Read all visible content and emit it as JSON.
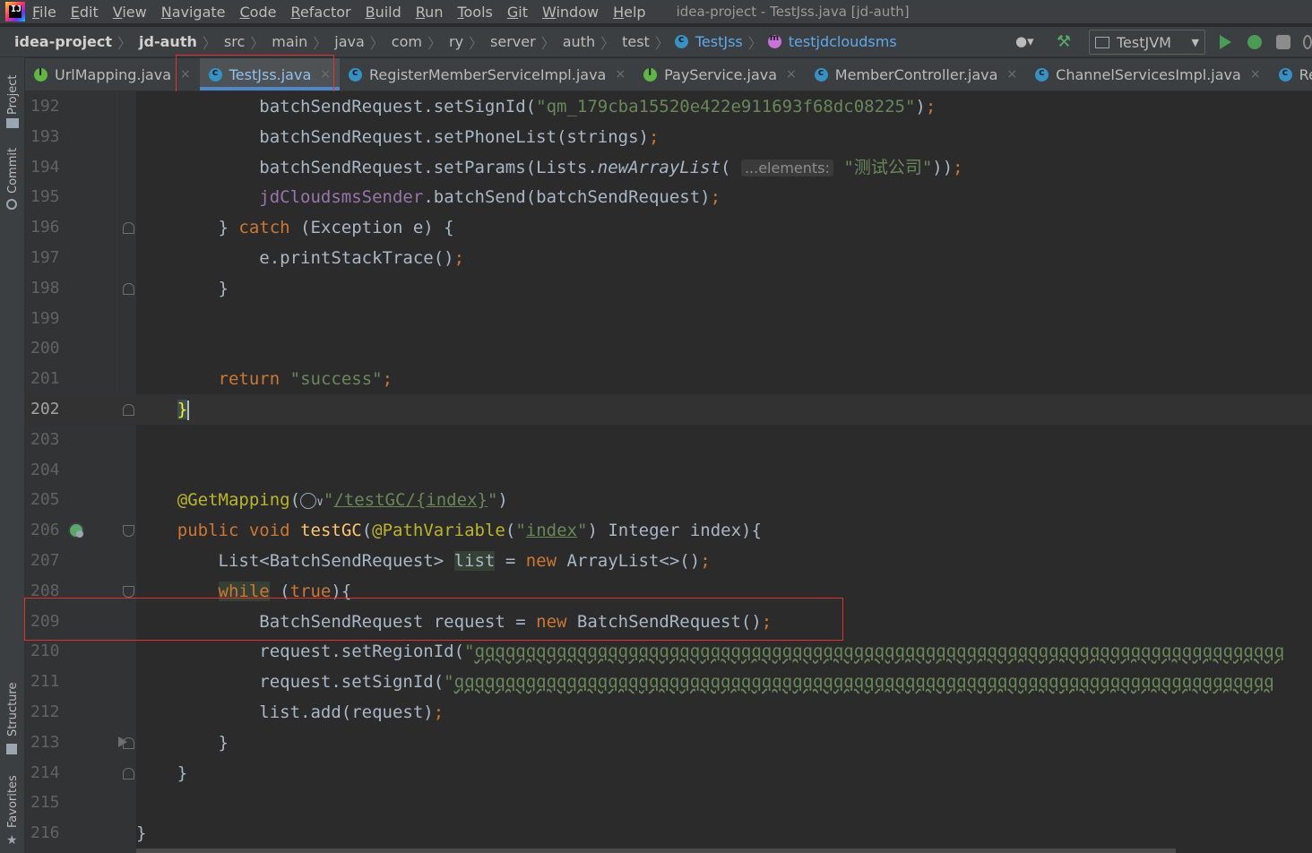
{
  "window": {
    "title": "idea-project - TestJss.java [jd-auth]"
  },
  "menu": [
    {
      "u": "F",
      "rest": "ile"
    },
    {
      "u": "E",
      "rest": "dit"
    },
    {
      "u": "V",
      "rest": "iew"
    },
    {
      "u": "N",
      "rest": "avigate"
    },
    {
      "u": "C",
      "rest": "ode"
    },
    {
      "u": "R",
      "rest": "efactor"
    },
    {
      "u": "B",
      "rest": "uild"
    },
    {
      "u": "R",
      "rest": "un"
    },
    {
      "u": "T",
      "rest": "ools"
    },
    {
      "u": "G",
      "rest": "it"
    },
    {
      "u": "W",
      "rest": "indow"
    },
    {
      "u": "H",
      "rest": "elp"
    }
  ],
  "breadcrumb": {
    "project": "idea-project",
    "module": "jd-auth",
    "path": [
      "src",
      "main",
      "java",
      "com",
      "ry",
      "server",
      "auth",
      "test"
    ],
    "class": "TestJss",
    "method": "testjdcloudsms"
  },
  "run_config": {
    "name": "TestJVM"
  },
  "tabs": [
    {
      "label": "UrlMapping.java",
      "icon": "interface-icon",
      "active": false
    },
    {
      "label": "TestJss.java",
      "icon": "class-icon",
      "active": true
    },
    {
      "label": "RegisterMemberServiceImpl.java",
      "icon": "class-icon",
      "active": false
    },
    {
      "label": "PayService.java",
      "icon": "interface-icon",
      "active": false
    },
    {
      "label": "MemberController.java",
      "icon": "class-icon",
      "active": false
    },
    {
      "label": "ChannelServicesImpl.java",
      "icon": "class-icon",
      "active": false
    },
    {
      "label": "RealNameRegist",
      "icon": "class-icon",
      "active": false
    }
  ],
  "side_tools": {
    "project": "Project",
    "commit": "Commit",
    "structure": "Structure",
    "favorites": "Favorites"
  },
  "code": {
    "line_numbers": [
      "192",
      "193",
      "194",
      "195",
      "196",
      "197",
      "198",
      "199",
      "200",
      "201",
      "202",
      "203",
      "204",
      "205",
      "206",
      "207",
      "208",
      "209",
      "210",
      "211",
      "212",
      "213",
      "214",
      "215",
      "216"
    ],
    "current_line": "202",
    "sign_id": "qm_179cba15520e422e911693f68dc08225",
    "params_hint": "...elements:",
    "params_value": "测试公司",
    "return_value": "success",
    "mapping_path": "/testGC/{index}",
    "path_var": "index",
    "q_string_1": "qqqqqqqqqqqqqqqqqqqqqqqqqqqqqqqqqqqqqqqqqqqqqqqqqqqqqqqqqqqqqqqqqqqqqqqqqqqqqqq",
    "q_string_2": "qqqqqqqqqqqqqqqqqqqqqqqqqqqqqqqqqqqqqqqqqqqqqqqqqqqqqqqqqqqqqqqqqqqqqqqqqqqqqqqq"
  },
  "colors": {
    "keyword": "#cc7832",
    "string": "#6a8759",
    "field": "#9876aa",
    "annotation": "#bbb529",
    "method": "#ffc66d",
    "highlight_box": "#e0302f"
  }
}
